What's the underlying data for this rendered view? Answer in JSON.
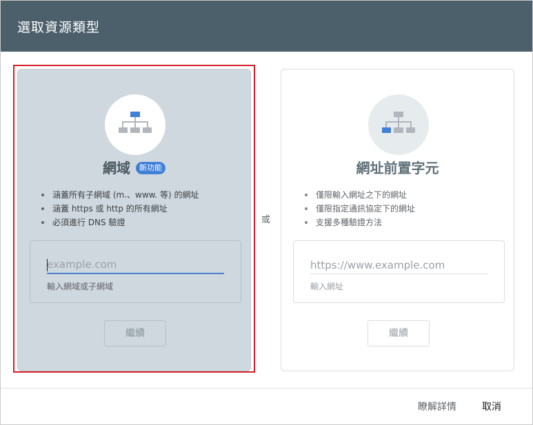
{
  "dialog": {
    "title": "選取資源類型"
  },
  "domain_card": {
    "title": "網域",
    "badge": "新功能",
    "bullets": [
      "涵蓋所有子網域 (m.、www. 等) 的網址",
      "涵蓋 https 或 http 的所有網址",
      "必須進行 DNS 驗證"
    ],
    "input": {
      "value": "",
      "placeholder": "example.com"
    },
    "helper": "輸入網域或子網域",
    "continue_label": "繼續"
  },
  "separator": {
    "or_label": "或"
  },
  "url_prefix_card": {
    "title": "網址前置字元",
    "bullets": [
      "僅限輸入網址之下的網址",
      "僅限指定通訊協定下的網址",
      "支援多種驗證方法"
    ],
    "input": {
      "value": "",
      "placeholder": "https://www.example.com"
    },
    "helper": "輸入網址",
    "continue_label": "繼續"
  },
  "footer": {
    "learn_more": "瞭解詳情",
    "cancel": "取消"
  },
  "colors": {
    "header_bg": "#4c606c",
    "selected_card_bg": "#cfd8df",
    "selection_border": "#d21f26",
    "badge_bg": "#3f80d6",
    "input_focus_line": "#4d7fd1"
  },
  "icons": {
    "domain_card_icon": "sitemap-icon",
    "url_prefix_card_icon": "sitemap-icon"
  }
}
